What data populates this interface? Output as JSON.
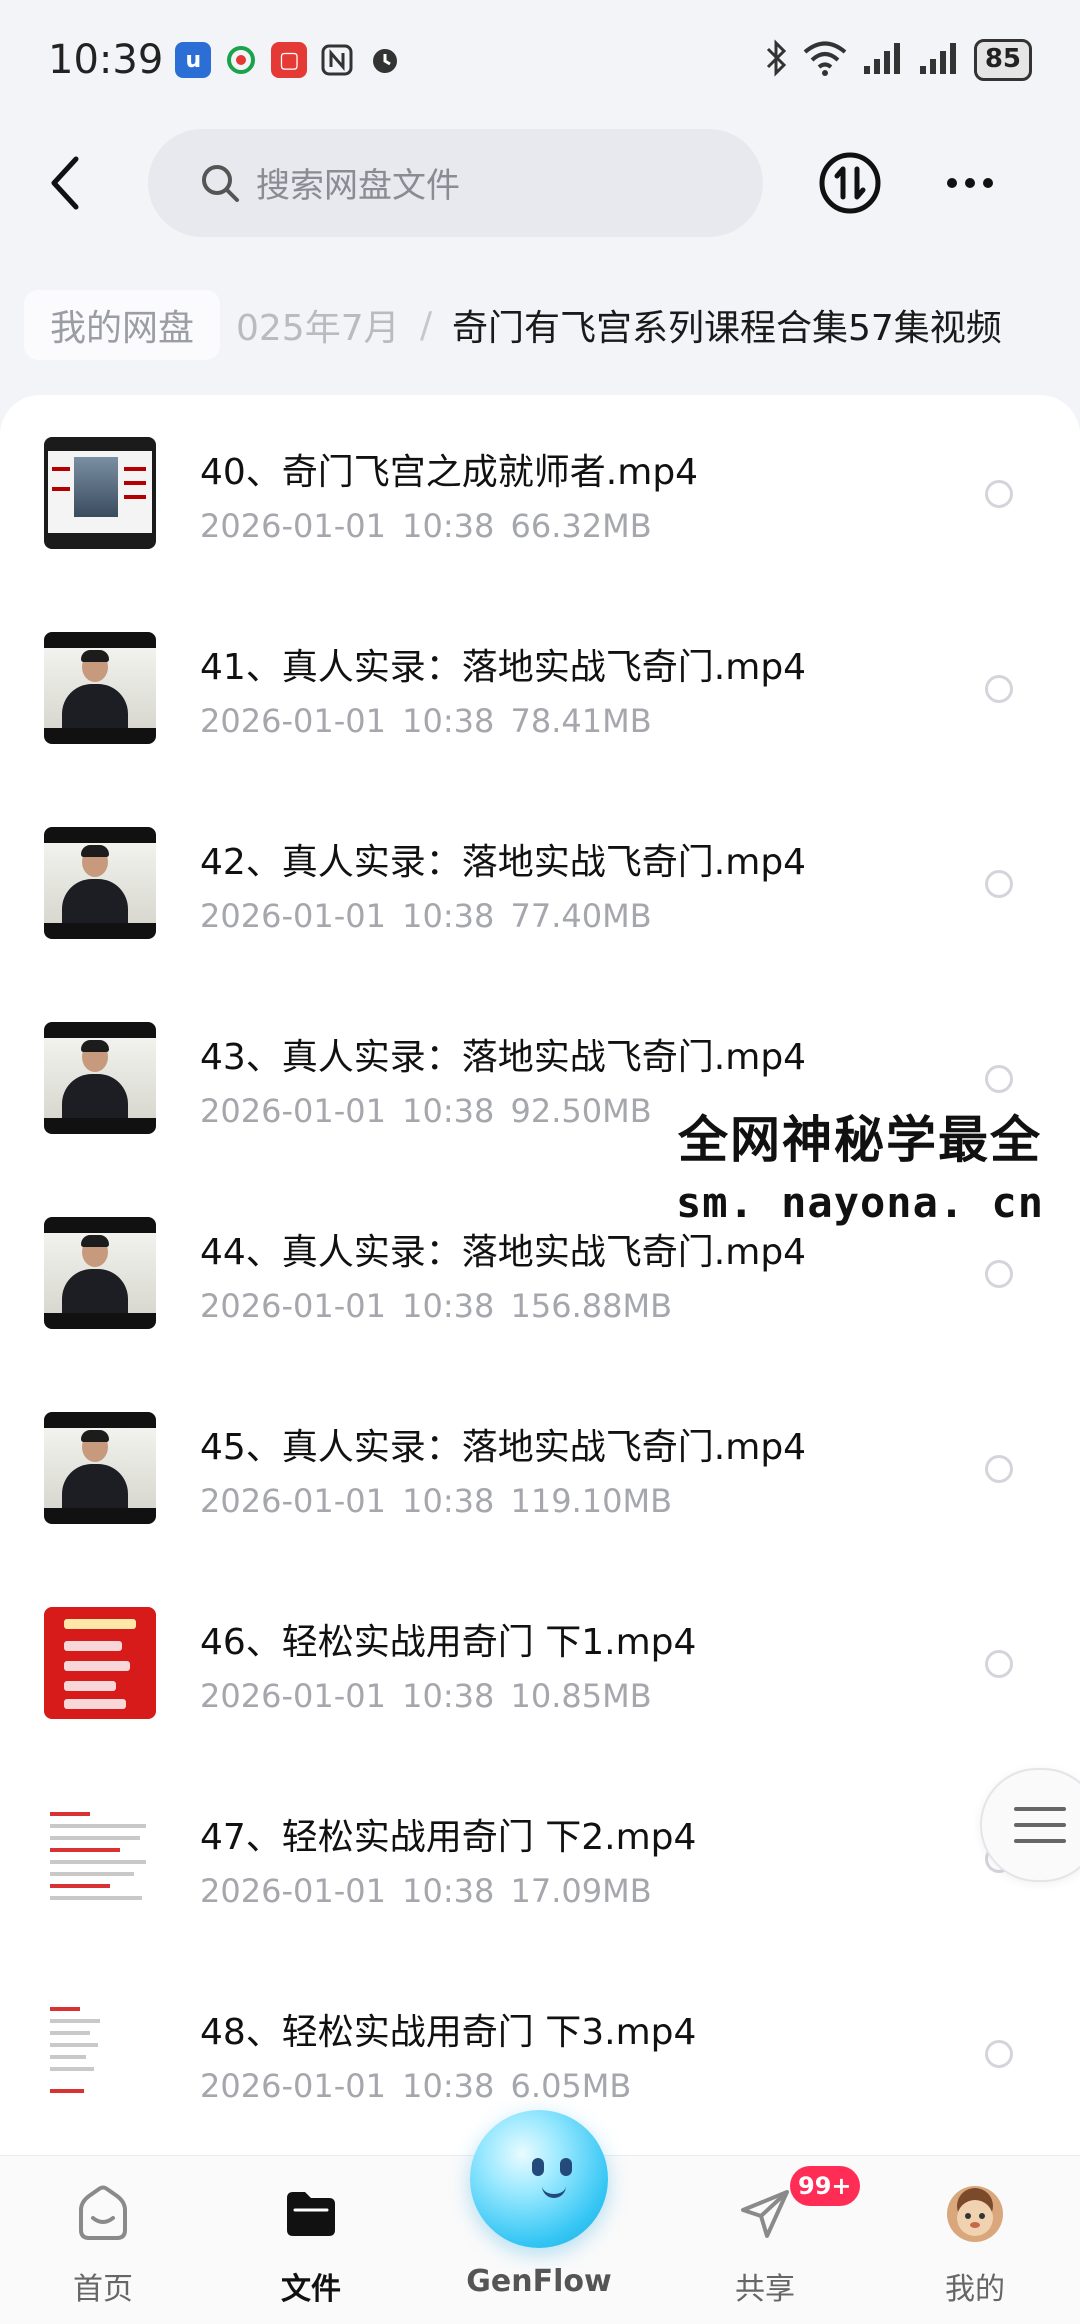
{
  "status_bar": {
    "time": "10:39",
    "battery": "85"
  },
  "header": {
    "search_placeholder": "搜索网盘文件"
  },
  "breadcrumb": {
    "root": "我的网盘",
    "middle": "025年7月",
    "separator": "/",
    "current": "奇门有飞宫系列课程合集57集视频"
  },
  "files": [
    {
      "name": "40、奇门飞宫之成就师者.mp4",
      "date": "2026-01-01",
      "time": "10:38",
      "size": "66.32MB",
      "thumb": "book"
    },
    {
      "name": "41、真人实录：落地实战飞奇门.mp4",
      "date": "2026-01-01",
      "time": "10:38",
      "size": "78.41MB",
      "thumb": "video"
    },
    {
      "name": "42、真人实录：落地实战飞奇门.mp4",
      "date": "2026-01-01",
      "time": "10:38",
      "size": "77.40MB",
      "thumb": "video"
    },
    {
      "name": "43、真人实录：落地实战飞奇门.mp4",
      "date": "2026-01-01",
      "time": "10:38",
      "size": "92.50MB",
      "thumb": "video"
    },
    {
      "name": "44、真人实录：落地实战飞奇门.mp4",
      "date": "2026-01-01",
      "time": "10:38",
      "size": "156.88MB",
      "thumb": "video"
    },
    {
      "name": "45、真人实录：落地实战飞奇门.mp4",
      "date": "2026-01-01",
      "time": "10:38",
      "size": "119.10MB",
      "thumb": "video"
    },
    {
      "name": "46、轻松实战用奇门 下1.mp4",
      "date": "2026-01-01",
      "time": "10:38",
      "size": "10.85MB",
      "thumb": "red-slide"
    },
    {
      "name": "47、轻松实战用奇门 下2.mp4",
      "date": "2026-01-01",
      "time": "10:38",
      "size": "17.09MB",
      "thumb": "document"
    },
    {
      "name": "48、轻松实战用奇门 下3.mp4",
      "date": "2026-01-01",
      "time": "10:38",
      "size": "6.05MB",
      "thumb": "document"
    }
  ],
  "watermark": {
    "line1": "全网神秘学最全",
    "line2": "sm. nayona. cn"
  },
  "bottom_nav": {
    "home": "首页",
    "files": "文件",
    "genflow": "GenFlow",
    "share": "共享",
    "mine": "我的",
    "share_badge": "99+"
  },
  "colors": {
    "accent": "#111111",
    "badge": "#ff2d55",
    "orb": "#35c6f4"
  }
}
